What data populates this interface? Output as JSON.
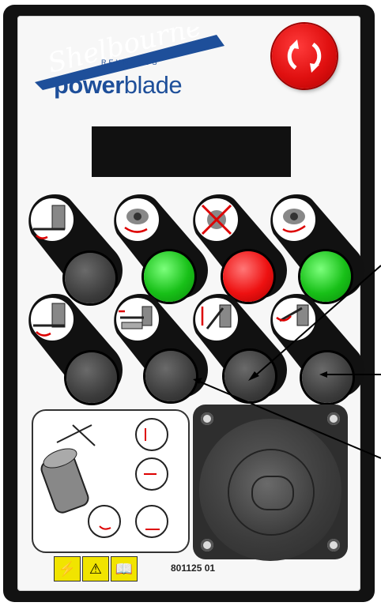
{
  "panel": {
    "brand": {
      "script_name": "Shelbourne",
      "sub_name": "REYNOLDS",
      "product_bold": "power",
      "product_regular": "blade"
    },
    "estop_icon": "rotate-release-icon",
    "part_number": "801125 01",
    "warnings": [
      "warning-triangle-icon",
      "read-manual-icon",
      "electric-hazard-icon"
    ],
    "button_rows": [
      [
        {
          "icon": "head-rotate-left-icon",
          "cap": "dark"
        },
        {
          "icon": "tilt-rotate-right-icon",
          "cap": "green"
        },
        {
          "icon": "blade-stop-icon",
          "cap": "red"
        },
        {
          "icon": "tilt-rotate-left-icon",
          "cap": "green"
        }
      ],
      [
        {
          "icon": "head-rotate-right-icon",
          "cap": "dark"
        },
        {
          "icon": "arm-extend-icon",
          "cap": "dark"
        },
        {
          "icon": "lift-icon",
          "cap": "dark"
        },
        {
          "icon": "float-icon",
          "cap": "dark"
        }
      ]
    ]
  }
}
